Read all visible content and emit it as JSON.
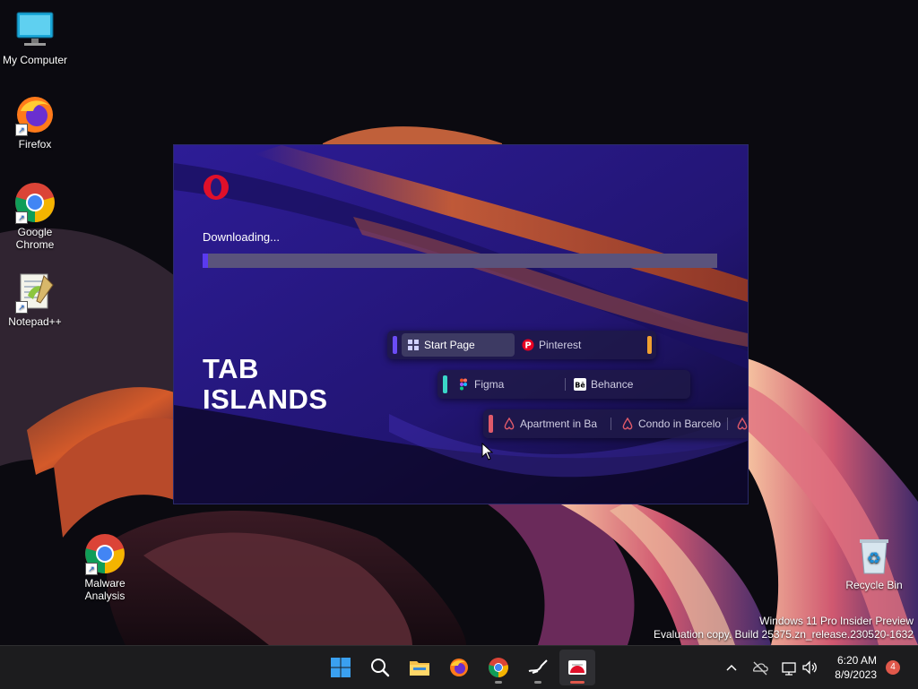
{
  "desktop": {
    "icons": [
      {
        "label": "My Computer"
      },
      {
        "label": "Firefox"
      },
      {
        "label": "Google\nChrome",
        "line1": "Google",
        "line2": "Chrome"
      },
      {
        "label": "Notepad++"
      },
      {
        "label": "Malware Analysis",
        "line1": "Malware",
        "line2": "Analysis"
      },
      {
        "label": "Recycle Bin"
      }
    ],
    "watermark": {
      "line1": "Windows 11 Pro Insider Preview",
      "line2": "Evaluation copy. Build 25375.zn_release.230520-1632"
    }
  },
  "installer": {
    "status": "Downloading...",
    "progress_fraction": 0.01,
    "promo_title_line1": "TAB",
    "promo_title_line2": "ISLANDS",
    "islands": [
      {
        "tabs": [
          "Start Page",
          "Pinterest"
        ],
        "accent": "#6b4cf5",
        "right_accent": "#f0a030"
      },
      {
        "tabs": [
          "Figma",
          "Behance"
        ],
        "accent": "#3ad6c8"
      },
      {
        "tabs": [
          "Apartment in Ba",
          "Condo in Barcelo"
        ],
        "accent": "#e05a6a"
      }
    ]
  },
  "taskbar": {
    "apps": [
      "start-icon",
      "search-icon",
      "file-explorer-icon",
      "firefox-icon",
      "chrome-icon",
      "app-icon",
      "opera-installer-icon"
    ],
    "time": "6:20 AM",
    "date": "8/9/2023",
    "notification_count": "4"
  },
  "colors": {
    "accent": "#5a3af0",
    "taskbar": "#1c1c1e",
    "window_bg": "#26177a"
  }
}
